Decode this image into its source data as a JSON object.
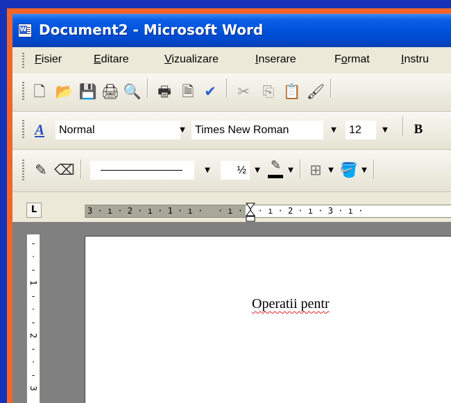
{
  "window": {
    "title": "Document2 - Microsoft Word"
  },
  "menu": {
    "items": [
      {
        "pre": "",
        "u": "F",
        "post": "isier"
      },
      {
        "pre": "",
        "u": "E",
        "post": "ditare"
      },
      {
        "pre": "",
        "u": "V",
        "post": "izualizare"
      },
      {
        "pre": "",
        "u": "I",
        "post": "nserare"
      },
      {
        "pre": "F",
        "u": "o",
        "post": "rmat"
      },
      {
        "pre": "",
        "u": "I",
        "post": "nstru"
      }
    ]
  },
  "formatting": {
    "style": "Normal",
    "font": "Times New Roman",
    "size": "12",
    "bold_label": "B"
  },
  "drawing": {
    "line_weight": "½"
  },
  "ruler": {
    "horizontal": "3 · ı · 2 · ı · 1 · ı ·   · ı · 1 · ı · 2 · ı · 3 · ı ·",
    "vertical": [
      "-",
      "·",
      "-",
      "1",
      "-",
      "·",
      "-",
      "2",
      "-",
      "·",
      "-",
      "3"
    ],
    "tab_selector": "L"
  },
  "document": {
    "text": "Operatii pentr"
  },
  "colors": {
    "background": "#1633b8",
    "frame": "#f4652a",
    "titlebar": "#0050d8",
    "chrome": "#ece9d8",
    "spellcheck": "#e02020"
  }
}
